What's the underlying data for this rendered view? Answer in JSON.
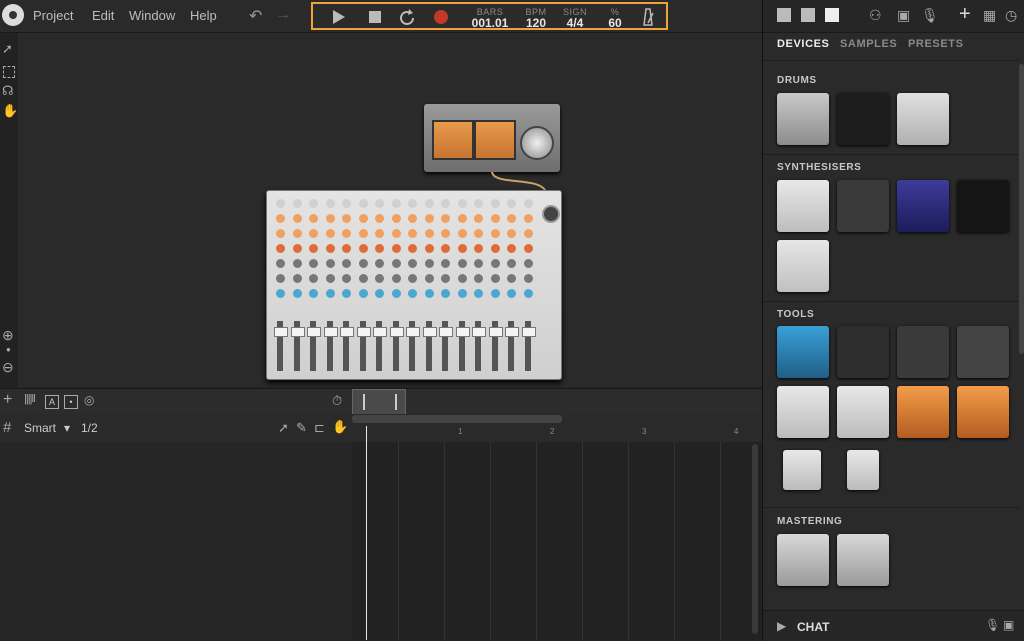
{
  "menu": [
    "Project",
    "Edit",
    "Window",
    "Help"
  ],
  "transport": {
    "bars_label": "BARS",
    "bars_value": "001.01",
    "bpm_label": "BPM",
    "bpm_value": "120",
    "sign_label": "SIGN",
    "sign_value": "4/4",
    "pct_label": "%",
    "pct_value": "60"
  },
  "timeline": {
    "mode": "Smart",
    "fraction": "1/2",
    "ruler_numbers": [
      "1",
      "2",
      "3",
      "4"
    ]
  },
  "browser": {
    "tabs": [
      "DEVICES",
      "SAMPLES",
      "PRESETS"
    ],
    "active_tab": "DEVICES",
    "sections": {
      "drums": "DRUMS",
      "synths": "SYNTHESISERS",
      "tools": "TOOLS",
      "mastering": "MASTERING"
    }
  },
  "chat": {
    "label": "CHAT"
  },
  "colors": {
    "transport_highlight": "#f0a33a",
    "record": "#c0392b"
  }
}
